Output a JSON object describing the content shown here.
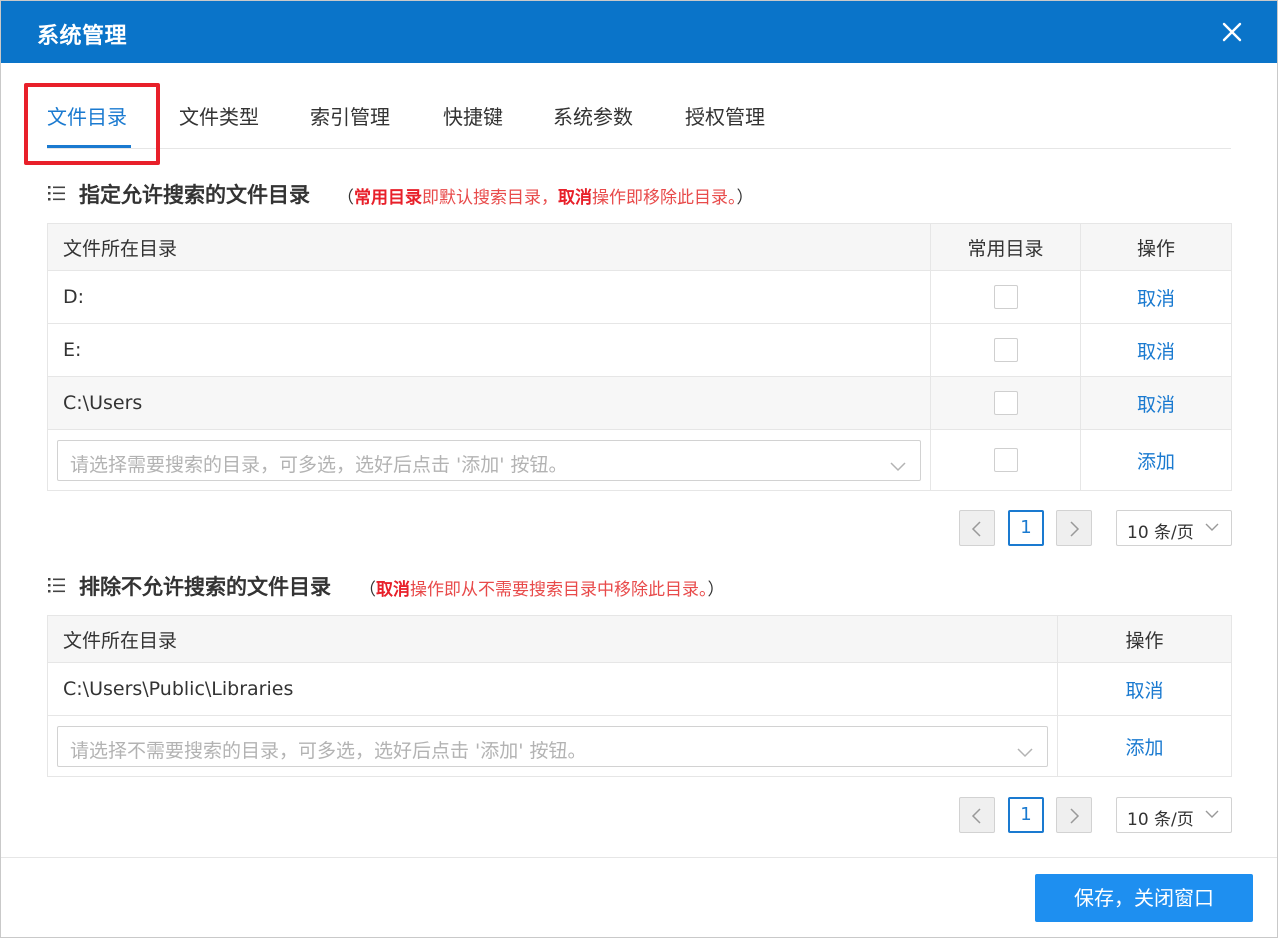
{
  "window": {
    "title": "系统管理"
  },
  "tabs": [
    {
      "label": "文件目录",
      "active": true
    },
    {
      "label": "文件类型"
    },
    {
      "label": "索引管理"
    },
    {
      "label": "快捷键"
    },
    {
      "label": "系统参数"
    },
    {
      "label": "授权管理"
    }
  ],
  "include_section": {
    "title": "指定允许搜索的文件目录",
    "note_open": "（",
    "note_bold1": "常用目录",
    "note_text1": "即默认搜索目录，",
    "note_bold2": "取消",
    "note_text2": "操作即移除此目录。",
    "note_close": "）",
    "columns": {
      "dir": "文件所在目录",
      "common": "常用目录",
      "action": "操作"
    },
    "rows": [
      {
        "dir": "D:",
        "common": false,
        "action": "取消"
      },
      {
        "dir": "E:",
        "common": false,
        "action": "取消"
      },
      {
        "dir": "C:\\Users",
        "common": false,
        "action": "取消"
      }
    ],
    "select_placeholder": "请选择需要搜索的目录，可多选，选好后点击 '添加' 按钮。",
    "add_action": "添加",
    "pager": {
      "current_page": "1",
      "page_size": "10 条/页"
    }
  },
  "exclude_section": {
    "title": "排除不允许搜索的文件目录",
    "note_open": "（",
    "note_bold1": "取消",
    "note_text1": "操作即从不需要搜索目录中移除此目录。",
    "note_close": "）",
    "columns": {
      "dir": "文件所在目录",
      "action": "操作"
    },
    "rows": [
      {
        "dir": "C:\\Users\\Public\\Libraries",
        "action": "取消"
      }
    ],
    "select_placeholder": "请选择不需要搜索的目录，可多选，选好后点击 '添加' 按钮。",
    "add_action": "添加",
    "pager": {
      "current_page": "1",
      "page_size": "10 条/页"
    }
  },
  "footer": {
    "save_label": "保存，关闭窗口"
  },
  "colors": {
    "titlebar": "#0a74c9",
    "accent": "#1a7ad0",
    "note_red": "#e8202a",
    "save_button": "#1e8ff0",
    "highlight_box": "#e8202a"
  }
}
